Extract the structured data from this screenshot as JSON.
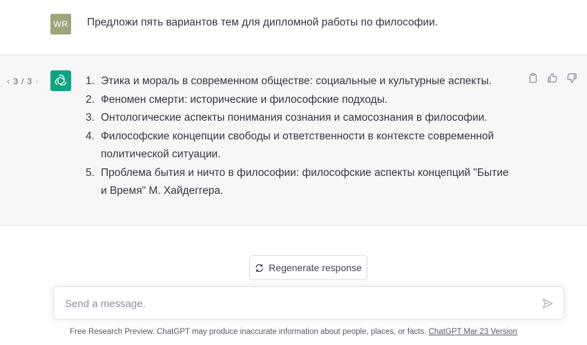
{
  "user_message": {
    "avatar_initials": "WR",
    "text": "Предложи пять вариантов тем для дипломной работы по философии."
  },
  "assistant_message": {
    "pager": {
      "current": "3",
      "separator": "/",
      "total": "3"
    },
    "items": [
      {
        "num": "1.",
        "text": "Этика и мораль в современном обществе: социальные и культурные аспекты."
      },
      {
        "num": "2.",
        "text": "Феномен смерти: исторические и философские подходы."
      },
      {
        "num": "3.",
        "text": "Онтологические аспекты понимания сознания и самосознания в философии."
      },
      {
        "num": "4.",
        "text": "Философские концепции свободы и ответственности в контексте современной политической ситуации."
      },
      {
        "num": "5.",
        "text": "Проблема бытия и ничто в философии: философские аспекты концепций \"Бытие и Время\" М. Хайдеггера."
      }
    ]
  },
  "regenerate": {
    "label": "Regenerate response"
  },
  "composer": {
    "placeholder": "Send a message."
  },
  "footer": {
    "text": "Free Research Preview. ChatGPT may produce inaccurate information about people, places, or facts.",
    "link": "ChatGPT Mar 23 Version"
  },
  "colors": {
    "assistant_bg": "#f7f7f8",
    "user_avatar": "#a0a57c",
    "gpt_avatar": "#10a37f",
    "text": "#343541"
  },
  "icons": {
    "pager_prev": "chevron-left-icon",
    "pager_next": "chevron-right-icon",
    "gpt_logo": "openai-logo-icon",
    "copy": "clipboard-icon",
    "like": "thumbs-up-icon",
    "dislike": "thumbs-down-icon",
    "regenerate": "refresh-icon",
    "send": "send-icon"
  }
}
